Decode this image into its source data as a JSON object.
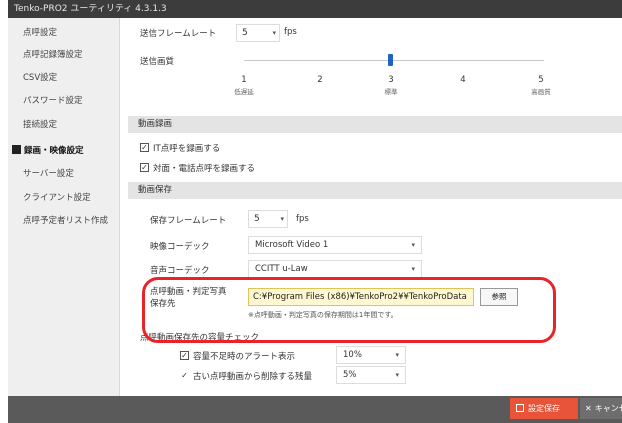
{
  "window": {
    "title": "Tenko-PRO2 ユーティリティ 4.3.1.3"
  },
  "sidebar": {
    "items": [
      {
        "label": "点呼設定",
        "active": false
      },
      {
        "label": "点呼記録簿設定",
        "active": false
      },
      {
        "label": "CSV設定",
        "active": false
      },
      {
        "label": "パスワード設定",
        "active": false
      },
      {
        "label": "接続設定",
        "active": false
      },
      {
        "label": "録画・映像設定",
        "active": true
      },
      {
        "label": "サーバー設定",
        "active": false
      },
      {
        "label": "クライアント設定",
        "active": false
      },
      {
        "label": "点呼予定者リスト作成",
        "active": false
      }
    ]
  },
  "transmission": {
    "frame_rate_label": "送信フレームレート",
    "frame_rate_value": "5",
    "frame_rate_unit": "fps",
    "quality_label": "送信画質",
    "quality_level": 3,
    "ticks": [
      {
        "num": "1",
        "sub": "低遅延"
      },
      {
        "num": "2",
        "sub": ""
      },
      {
        "num": "3",
        "sub": "標準"
      },
      {
        "num": "4",
        "sub": ""
      },
      {
        "num": "5",
        "sub": "高画質"
      }
    ]
  },
  "recording": {
    "section_title": "動画録画",
    "check1_label": "IT点呼を録画する",
    "check2_label": "対面・電話点呼を録画する"
  },
  "save": {
    "section_title": "動画保存",
    "frame_rate_label": "保存フレームレート",
    "frame_rate_value": "5",
    "frame_rate_unit": "fps",
    "video_codec_label": "映像コーデック",
    "video_codec_value": "Microsoft Video 1",
    "audio_codec_label": "音声コーデック",
    "audio_codec_value": "CCITT u-Law",
    "dest_label_line1": "点呼動画・判定写真",
    "dest_label_line2": "保存先",
    "dest_path": "C:¥Program Files (x86)¥TenkoPro2¥¥TenkoProData",
    "browse_label": "参照",
    "dest_note": "※点呼動画・判定写真の保存期間は1年間です。"
  },
  "capacity": {
    "section_title": "点呼動画保存先の容量チェック",
    "warn_label": "容量不足時のアラート表示",
    "warn_value": "10%",
    "delete_label": "古い点呼動画から削除する残量",
    "delete_value": "5%"
  },
  "footer": {
    "save_label": "設定保存",
    "cancel_label": "キャンセル"
  }
}
